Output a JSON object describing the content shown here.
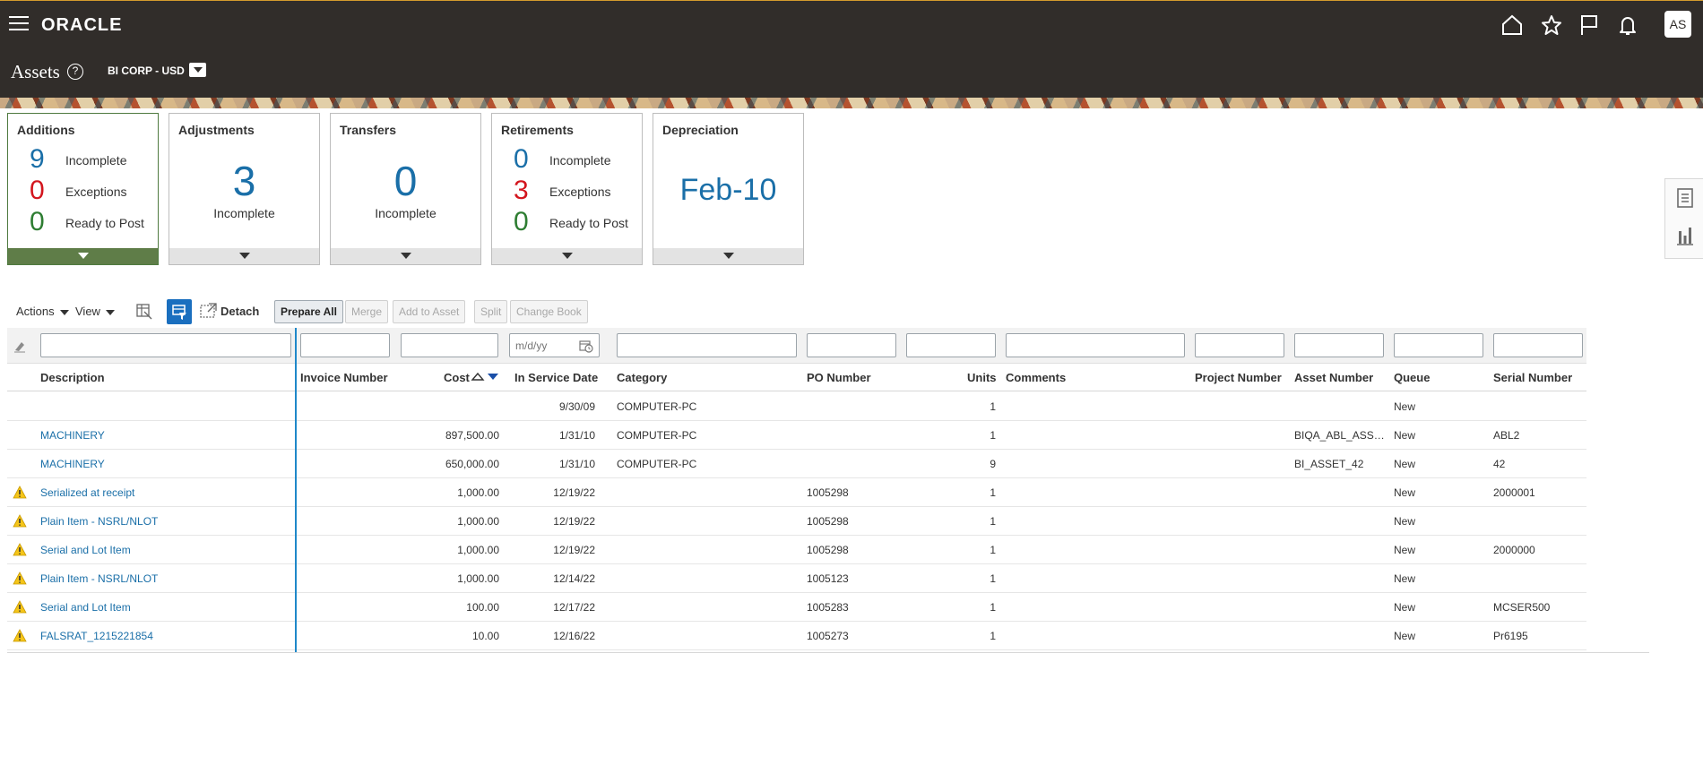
{
  "header": {
    "brand": "ORACLE",
    "avatar_initials": "AS",
    "icons": [
      "home-icon",
      "favorites-icon",
      "watchlist-flag-icon",
      "notifications-bell-icon"
    ]
  },
  "page": {
    "title": "Assets",
    "book_selector": "BI CORP - USD"
  },
  "infolets": {
    "additions": {
      "title": "Additions",
      "metrics": [
        {
          "value": "9",
          "label": "Incomplete",
          "color": "#1a6fa8"
        },
        {
          "value": "0",
          "label": "Exceptions",
          "color": "#d3161e"
        },
        {
          "value": "0",
          "label": "Ready to Post",
          "color": "#2e7d32"
        }
      ]
    },
    "adjustments": {
      "title": "Adjustments",
      "value": "3",
      "label": "Incomplete"
    },
    "transfers": {
      "title": "Transfers",
      "value": "0",
      "label": "Incomplete"
    },
    "retirements": {
      "title": "Retirements",
      "metrics": [
        {
          "value": "0",
          "label": "Incomplete",
          "color": "#1a6fa8"
        },
        {
          "value": "3",
          "label": "Exceptions",
          "color": "#d3161e"
        },
        {
          "value": "0",
          "label": "Ready to Post",
          "color": "#2e7d32"
        }
      ]
    },
    "depreciation": {
      "title": "Depreciation",
      "value": "Feb-10"
    }
  },
  "toolbar": {
    "actions_label": "Actions",
    "view_label": "View",
    "detach_label": "Detach",
    "prepare_all_label": "Prepare All",
    "merge_label": "Merge",
    "add_to_asset_label": "Add to Asset",
    "split_label": "Split",
    "change_book_label": "Change Book"
  },
  "filters": {
    "date_placeholder": "m/d/yy"
  },
  "table": {
    "columns": [
      "Description",
      "Invoice Number",
      "Cost",
      "In Service Date",
      "Category",
      "PO Number",
      "Units",
      "Comments",
      "Project Number",
      "Asset Number",
      "Queue",
      "Serial Number"
    ],
    "rows": [
      {
        "warning": false,
        "description": "",
        "invoice": "",
        "cost": "",
        "date": "9/30/09",
        "category": "COMPUTER-PC",
        "po": "",
        "units": "1",
        "comments": "",
        "project": "",
        "asset": "",
        "queue": "New",
        "serial": ""
      },
      {
        "warning": false,
        "description": "MACHINERY",
        "invoice": "",
        "cost": "897,500.00",
        "date": "1/31/10",
        "category": "COMPUTER-PC",
        "po": "",
        "units": "1",
        "comments": "",
        "project": "",
        "asset": "BIQA_ABL_ASS…",
        "queue": "New",
        "serial": "ABL2"
      },
      {
        "warning": false,
        "description": "MACHINERY",
        "invoice": "",
        "cost": "650,000.00",
        "date": "1/31/10",
        "category": "COMPUTER-PC",
        "po": "",
        "units": "9",
        "comments": "",
        "project": "",
        "asset": "BI_ASSET_42",
        "queue": "New",
        "serial": "42"
      },
      {
        "warning": true,
        "description": "Serialized at receipt",
        "invoice": "",
        "cost": "1,000.00",
        "date": "12/19/22",
        "category": "",
        "po": "1005298",
        "units": "1",
        "comments": "",
        "project": "",
        "asset": "",
        "queue": "New",
        "serial": "2000001"
      },
      {
        "warning": true,
        "description": "Plain Item - NSRL/NLOT",
        "invoice": "",
        "cost": "1,000.00",
        "date": "12/19/22",
        "category": "",
        "po": "1005298",
        "units": "1",
        "comments": "",
        "project": "",
        "asset": "",
        "queue": "New",
        "serial": ""
      },
      {
        "warning": true,
        "description": "Serial and Lot Item",
        "invoice": "",
        "cost": "1,000.00",
        "date": "12/19/22",
        "category": "",
        "po": "1005298",
        "units": "1",
        "comments": "",
        "project": "",
        "asset": "",
        "queue": "New",
        "serial": "2000000"
      },
      {
        "warning": true,
        "description": "Plain Item - NSRL/NLOT",
        "invoice": "",
        "cost": "1,000.00",
        "date": "12/14/22",
        "category": "",
        "po": "1005123",
        "units": "1",
        "comments": "",
        "project": "",
        "asset": "",
        "queue": "New",
        "serial": ""
      },
      {
        "warning": true,
        "description": "Serial and Lot Item",
        "invoice": "",
        "cost": "100.00",
        "date": "12/17/22",
        "category": "",
        "po": "1005283",
        "units": "1",
        "comments": "",
        "project": "",
        "asset": "",
        "queue": "New",
        "serial": "MCSER500"
      },
      {
        "warning": true,
        "description": "FALSRAT_1215221854",
        "invoice": "",
        "cost": "10.00",
        "date": "12/16/22",
        "category": "",
        "po": "1005273",
        "units": "1",
        "comments": "",
        "project": "",
        "asset": "",
        "queue": "New",
        "serial": "Pr6195"
      }
    ]
  },
  "colors": {
    "header_bg": "#312d2a",
    "link": "#1a6fa8",
    "exception": "#d3161e",
    "ready": "#2e7d32",
    "selected_tile": "#5f7d48"
  }
}
